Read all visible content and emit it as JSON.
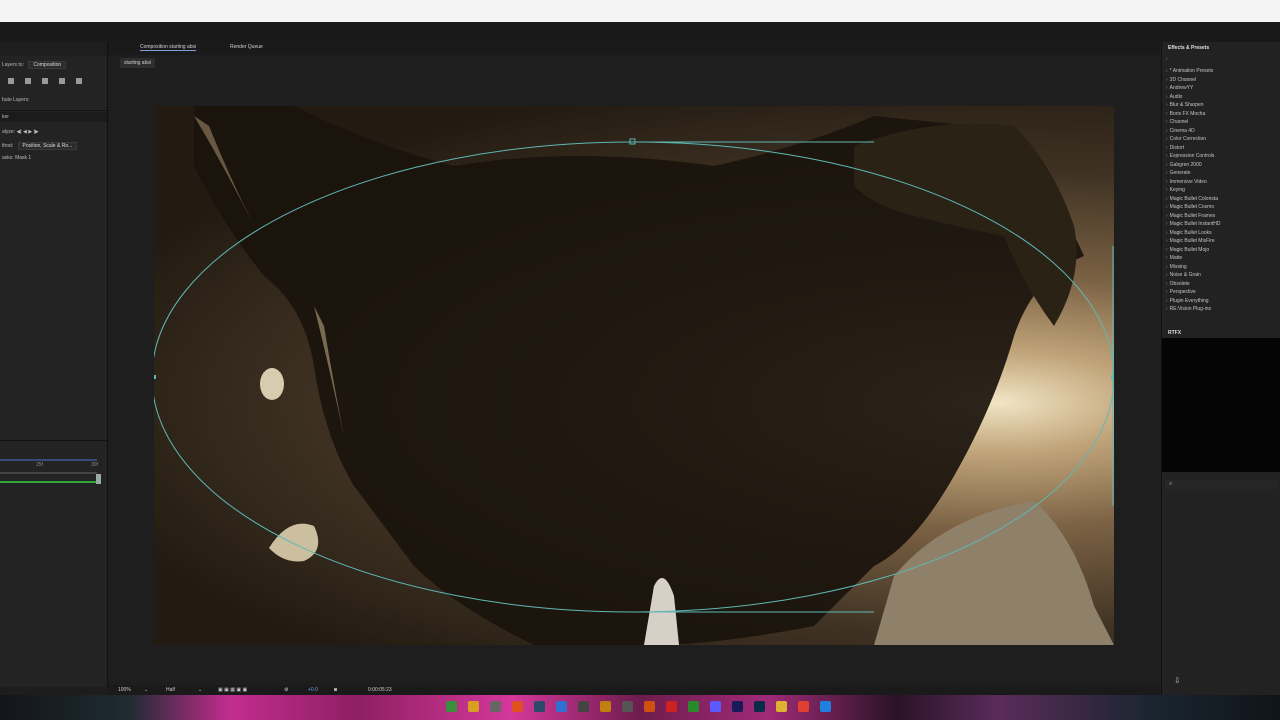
{
  "left_panel": {
    "align_layers_label": "Layers to:",
    "align_layers_value": "Composition",
    "distribute_label": "bute Layers:",
    "tracker_title": "ker",
    "analyze_label": "alyze:",
    "method_label": "thod:",
    "method_value": "Position, Scale & Ro...",
    "masks_label": "asks:",
    "masks_value": "Mask 1",
    "timeline_marks": [
      "25f",
      "30f"
    ]
  },
  "composition": {
    "tab_label": "Composition starting absi",
    "render_queue_label": "Render Queue",
    "breadcrumb": "starting absi"
  },
  "bottom_bar": {
    "zoom": "100%",
    "resolution": "Half",
    "exposure": "+0.0",
    "timecode": "0:00:05:23"
  },
  "effects_panel": {
    "title": "Effects & Presets",
    "items": [
      "* Animation Presets",
      "3D Channel",
      "AndrewYY",
      "Audio",
      "Blur & Sharpen",
      "Boris FX Mocha",
      "Channel",
      "Cinema 4D",
      "Color Correction",
      "Distort",
      "Expression Controls",
      "Gabgren 2000",
      "Generate",
      "Immersive Video",
      "Keying",
      "Magic Bullet Colorista",
      "Magic Bullet Cosmo",
      "Magic Bullet Frames",
      "Magic Bullet InstantHD",
      "Magic Bullet Looks",
      "Magic Bullet MisFire",
      "Magic Bullet Mojo",
      "Matte",
      "Missing",
      "Noise & Grain",
      "Obsolete",
      "Perspective",
      "Plugin Everything",
      "RE:Vision Plug-ins"
    ]
  },
  "rtfx_panel": {
    "title": "RTFX"
  },
  "colors": {
    "mask_path": "#5fb8b4",
    "accent": "#7f9fd8",
    "timeline_green": "#2fa63a"
  }
}
